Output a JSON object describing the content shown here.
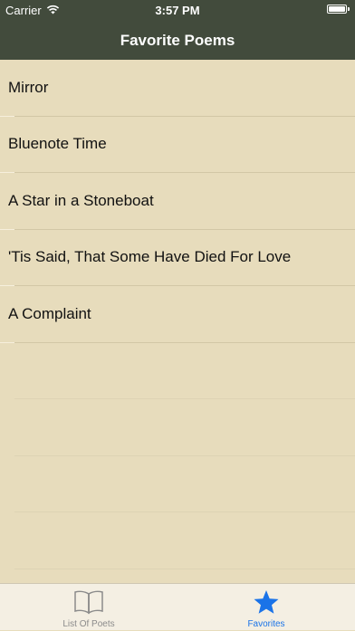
{
  "status_bar": {
    "carrier": "Carrier",
    "time": "3:57 PM"
  },
  "nav": {
    "title": "Favorite Poems"
  },
  "poems": [
    {
      "title": "Mirror"
    },
    {
      "title": "Bluenote Time"
    },
    {
      "title": "A Star in a Stoneboat"
    },
    {
      "title": "'Tis Said, That Some Have Died For Love"
    },
    {
      "title": "A Complaint"
    }
  ],
  "tab_bar": {
    "tabs": [
      {
        "label": "List Of Poets",
        "icon": "book-icon",
        "selected": false
      },
      {
        "label": "Favorites",
        "icon": "star-icon",
        "selected": true
      }
    ]
  },
  "colors": {
    "nav_background": "#424b3c",
    "list_background": "#e7dcbc",
    "tab_selected": "#1a73e8",
    "tab_unselected": "#8b8b8b"
  }
}
